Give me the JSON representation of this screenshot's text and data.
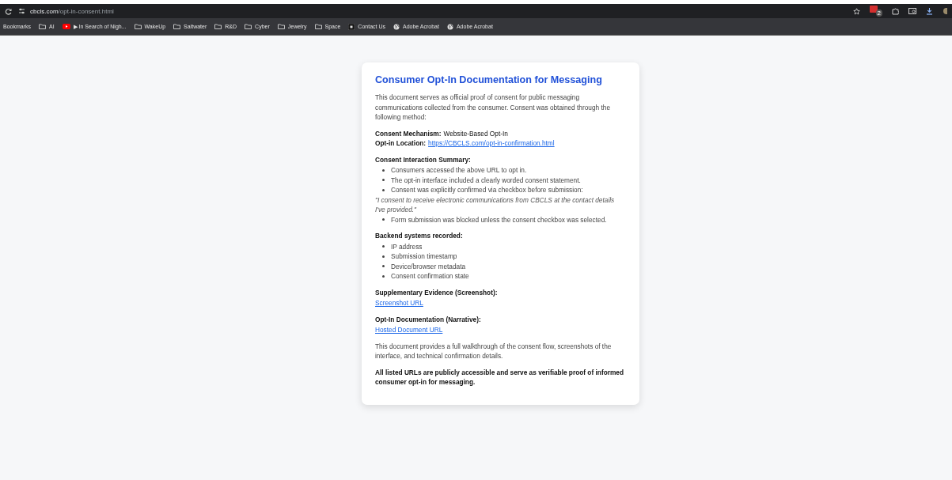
{
  "browser": {
    "address": {
      "host": "cbcls.com",
      "path": "/opt-in-consent.html"
    },
    "extension_badge": "2",
    "bookmarks": [
      {
        "kind": "label",
        "label": "Bookmarks"
      },
      {
        "kind": "folder",
        "label": "AI"
      },
      {
        "kind": "video",
        "label": "▶ In Search of Nigh..."
      },
      {
        "kind": "folder",
        "label": "WakeUp"
      },
      {
        "kind": "folder",
        "label": "Saltwater"
      },
      {
        "kind": "folder",
        "label": "R&D"
      },
      {
        "kind": "folder",
        "label": "Cyber"
      },
      {
        "kind": "folder",
        "label": "Jewelry"
      },
      {
        "kind": "folder",
        "label": "Space"
      },
      {
        "kind": "page",
        "label": "Contact Us"
      },
      {
        "kind": "globe",
        "label": "Adobe Acrobat"
      },
      {
        "kind": "globe",
        "label": "Adobe Acrobat"
      }
    ]
  },
  "document": {
    "title": "Consumer Opt-In Documentation for Messaging",
    "blocks": [
      {
        "kind": "paragraph",
        "text": "This document serves as official proof of consent for public messaging communications collected from the consumer. Consent was obtained through the following method:"
      },
      {
        "kind": "fields",
        "items": [
          {
            "label": "Consent Mechanism:",
            "value": "Website-Based Opt-In"
          },
          {
            "label": "Opt-in Location:",
            "link": "https://CBCLS.com/opt-in-confirmation.html"
          }
        ]
      },
      {
        "kind": "list",
        "heading": "Consent Interaction Summary:",
        "items": [
          {
            "kind": "bullet",
            "text": "Consumers accessed the above URL to opt in."
          },
          {
            "kind": "bullet",
            "text": "The opt-in interface included a clearly worded consent statement."
          },
          {
            "kind": "bullet",
            "text": "Consent was explicitly confirmed via checkbox before submission:"
          },
          {
            "kind": "quote",
            "text": "\"I consent to receive electronic communications from CBCLS at the contact details I've provided.\""
          },
          {
            "kind": "bullet",
            "text": "Form submission was blocked unless the consent checkbox was selected."
          }
        ]
      },
      {
        "kind": "list",
        "heading": "Backend systems recorded:",
        "items": [
          {
            "kind": "bullet",
            "text": "IP address"
          },
          {
            "kind": "bullet",
            "text": "Submission timestamp"
          },
          {
            "kind": "bullet",
            "text": "Device/browser metadata"
          },
          {
            "kind": "bullet",
            "text": "Consent confirmation state"
          }
        ]
      },
      {
        "kind": "link_section",
        "heading": "Supplementary Evidence (Screenshot):",
        "link": "Screenshot URL"
      },
      {
        "kind": "link_section",
        "heading": "Opt-In Documentation (Narrative):",
        "link": "Hosted Document URL"
      },
      {
        "kind": "paragraph",
        "text": "This document provides a full walkthrough of the consent flow, screenshots of the interface, and technical confirmation details."
      },
      {
        "kind": "strong",
        "text": "All listed URLs are publicly accessible and serve as verifiable proof of informed consumer opt-in for messaging."
      }
    ]
  }
}
